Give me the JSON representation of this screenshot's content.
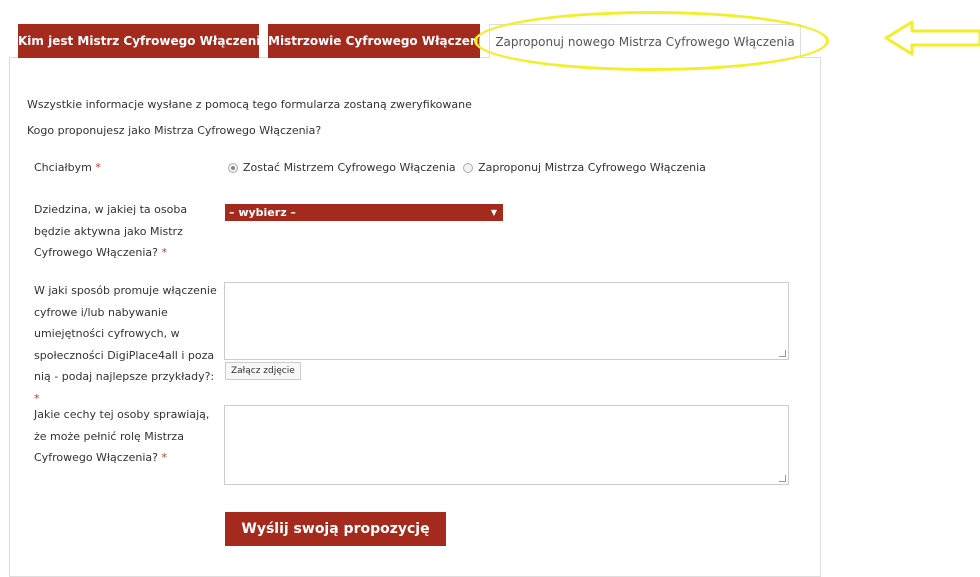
{
  "tabs": [
    {
      "label": "Kim jest Mistrz Cyfrowego Włączenia?"
    },
    {
      "label": "Mistrzowie Cyfrowego Włączenia"
    },
    {
      "label": "Zaproponuj nowego Mistrza Cyfrowego Włączenia"
    }
  ],
  "form": {
    "intro_1": "Wszystkie informacje wysłane z pomocą tego formularza zostaną zweryfikowane",
    "intro_2": "Kogo proponujesz jako Mistrza Cyfrowego Włączenia?",
    "required_mark": "*",
    "choice_label": "Chciałbym",
    "choice_option_1": "Zostać Mistrzem Cyfrowego Włączenia",
    "choice_option_2": "Zaproponuj Mistrza Cyfrowego Włączenia",
    "domain_label": "Dziedzina, w jakiej ta osoba będzie aktywna jako Mistrz Cyfrowego Włączenia?",
    "domain_select_value": "– wybierz –",
    "promote_label": "W jaki sposób promuje włączenie cyfrowe i/lub nabywanie umiejętności cyfrowych, w społeczności DigiPlace4all i poza nią - podaj najlepsze przykłady?:",
    "attach_label": "Załącz zdjęcie",
    "traits_label": "Jakie cechy tej osoby sprawiają, że może pełnić rolę Mistrza Cyfrowego Włączenia?",
    "submit_label": "Wyślij swoją propozycję"
  },
  "colors": {
    "accent": "#a42a1e",
    "highlight": "#f2ef2a"
  },
  "icons": {
    "select_caret": "triangle-down-icon",
    "annotation_arrow": "left-arrow-icon"
  }
}
